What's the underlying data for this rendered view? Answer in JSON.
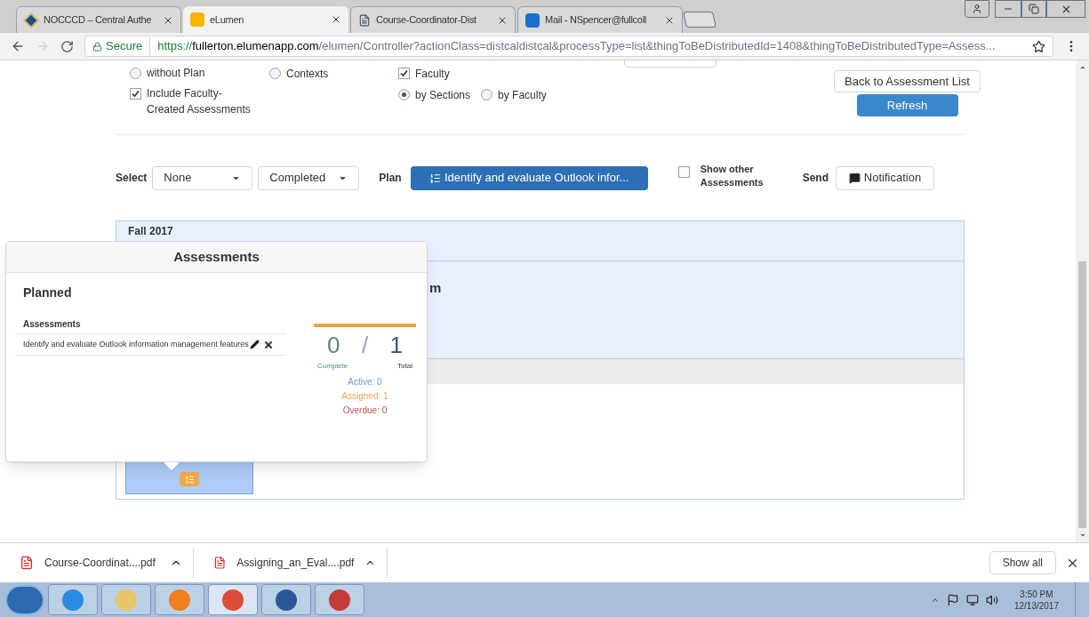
{
  "browser": {
    "tabs": [
      {
        "title": "NOCCCD – Central Authe",
        "kind": "diamond",
        "selected": false
      },
      {
        "title": "eLumen",
        "kind": "elumen",
        "selected": true
      },
      {
        "title": "Course-Coordinator-Dist",
        "kind": "doc",
        "selected": false
      },
      {
        "title": "Mail - NSpencer@fullcoll",
        "kind": "mail",
        "selected": false
      }
    ],
    "secure_label": "Secure",
    "url_scheme": "https://",
    "url_host": "fullerton.elumenapp.com",
    "url_path": "/elumen/Controller?actionClass=distcaldistcal&processType=list&thingToBeDistributedId=1408&thingToBeDistributedType=Assess..."
  },
  "filters": {
    "col1": [
      {
        "label": "without Plan",
        "kind": "radio",
        "checked": false
      },
      {
        "label": "Include Faculty-\nCreated Assessments",
        "kind": "checkbox",
        "checked": true
      }
    ],
    "col2": [
      {
        "label": "Contexts",
        "kind": "radio",
        "checked": false
      }
    ],
    "col3": [
      {
        "label": "Faculty",
        "checked": true
      }
    ],
    "col3_radios": [
      {
        "label": "by Sections",
        "selected": true
      },
      {
        "label": "by Faculty",
        "selected": false
      }
    ],
    "back_button": "Back to Assessment List",
    "refresh_button": "Refresh"
  },
  "toolbar": {
    "select_label": "Select",
    "dropdowns": [
      "None",
      "Completed"
    ],
    "plan_label": "Plan",
    "plan_button": "Identify and evaluate Outlook infor...",
    "show_other": {
      "label": "Show other\nAssessments",
      "checked": false
    },
    "send_label": "Send",
    "notification_button": "Notification"
  },
  "panel": {
    "term": "Fall 2017",
    "title_fragment": "m"
  },
  "popup": {
    "title": "Assessments",
    "section": "Planned",
    "list_heading": "Assessments",
    "items": [
      "Identify and evaluate Outlook information management features"
    ],
    "complete": "0",
    "separator": "/",
    "total": "1",
    "complete_label": "Complete",
    "total_label": "Total",
    "level": 0,
    "stats": [
      {
        "text": "Active: 0",
        "color": "#6a9bd8"
      },
      {
        "text": "Assigned: 1",
        "color": "#f0a45a"
      },
      {
        "text": "Overdue: 0",
        "color": "#c0504d"
      }
    ]
  },
  "downloads": {
    "files": [
      "Course-Coordinat....pdf",
      "Assigning_an_Eval....pdf"
    ],
    "show_all": "Show all"
  },
  "taskbar": {
    "time": "3:50 PM",
    "date": "12/13/2017"
  }
}
